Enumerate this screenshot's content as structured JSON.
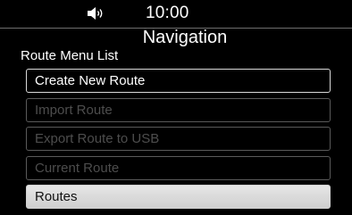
{
  "status": {
    "volume_icon": "speaker-volume-icon",
    "time": "10:00"
  },
  "header": {
    "title": "Navigation",
    "subtitle": "Route Menu List"
  },
  "menu": {
    "items": [
      {
        "label": "Create New Route",
        "state": "enabled"
      },
      {
        "label": "Import Route",
        "state": "disabled"
      },
      {
        "label": "Export Route to USB",
        "state": "disabled"
      },
      {
        "label": "Current Route",
        "state": "disabled"
      },
      {
        "label": "Routes",
        "state": "selected"
      }
    ]
  },
  "colors": {
    "background": "#000000",
    "text": "#ffffff",
    "disabled_text": "#4d4d4d",
    "selected_bg": "#d9d9d9"
  }
}
